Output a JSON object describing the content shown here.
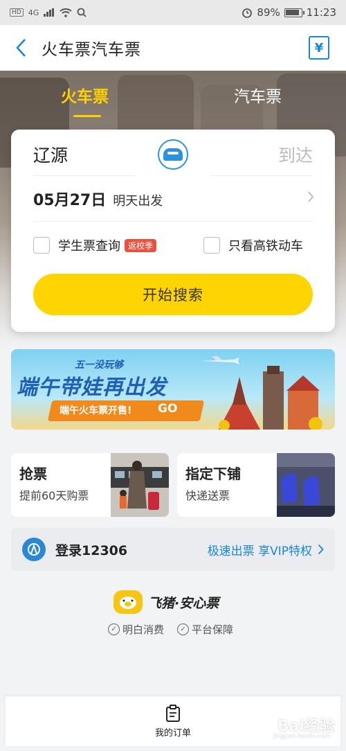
{
  "status": {
    "network": "HD",
    "signal": "4G",
    "battery_pct": "89%",
    "time": "11:23"
  },
  "nav": {
    "title": "火车票汽车票",
    "ticket_icon": "¥"
  },
  "tabs": [
    {
      "label": "火车票",
      "active": true
    },
    {
      "label": "汽车票",
      "active": false
    }
  ],
  "search": {
    "from": "辽源",
    "to": "到达",
    "date": "05月27日",
    "date_note": "明天出发",
    "student_label": "学生票查询",
    "student_tag": "返校季",
    "high_speed_label": "只看高铁动车",
    "button_label": "开始搜索"
  },
  "banner": {
    "small": "五一没玩够",
    "big": "端午带娃再出发",
    "sub": "端午火车票开售!",
    "go": "GO"
  },
  "promos": [
    {
      "title": "抢票",
      "subtitle": "提前60天购票"
    },
    {
      "title": "指定下铺",
      "subtitle": "快递送票"
    }
  ],
  "login": {
    "label": "登录12306",
    "link": "极速出票 享VIP特权"
  },
  "brand": {
    "name": "飞猪·安心票",
    "items": [
      "明白消费",
      "平台保障"
    ]
  },
  "bottom": {
    "orders_label": "我的订单"
  },
  "watermark": {
    "text": "Bai经验",
    "sub": "jingyan.baidu.com"
  },
  "colors": {
    "accent_blue": "#1a86d8",
    "accent_yellow": "#ffd400",
    "tag_red": "#e8523e"
  }
}
